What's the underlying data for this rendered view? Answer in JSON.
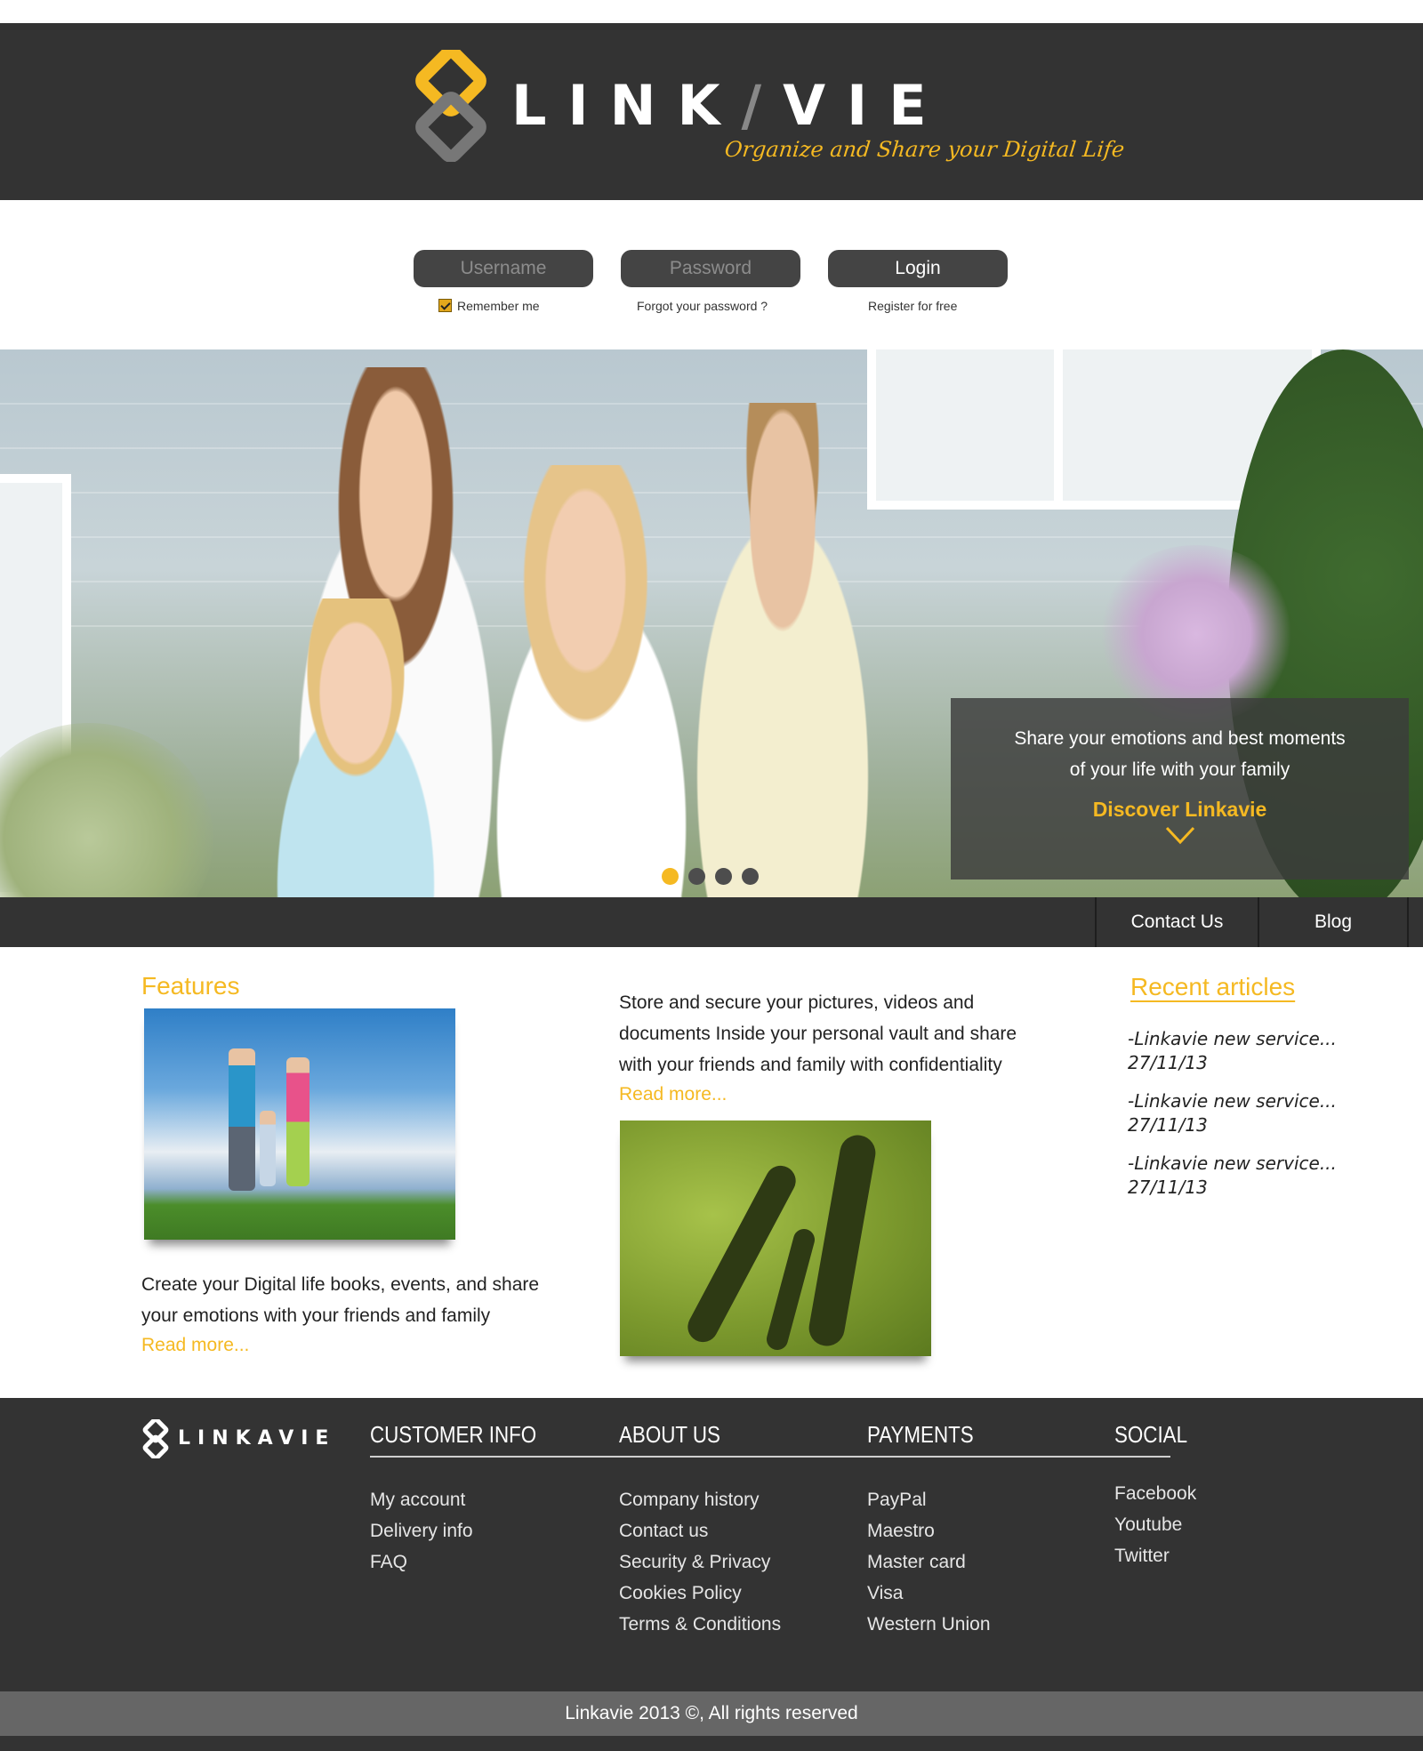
{
  "brand": {
    "name": "LINKAVIE",
    "tagline": "Organize and Share your Digital Life",
    "accent_color": "#f5b922",
    "dark_color": "#333333"
  },
  "login": {
    "username_placeholder": "Username",
    "password_placeholder": "Password",
    "login_label": "Login",
    "remember_label": "Remember me",
    "remember_checked": true,
    "forgot_label": "Forgot your password ?",
    "register_label": "Register for free"
  },
  "hero": {
    "caption_line1": "Share your emotions and best moments",
    "caption_line2": "of your life with your family",
    "discover_label": "Discover Linkavie",
    "slides_total": 4,
    "active_slide": 1
  },
  "nav": {
    "items": [
      {
        "label": "Contact Us"
      },
      {
        "label": "Blog"
      }
    ]
  },
  "features": {
    "title": "Features",
    "left_text_line1": "Create your Digital life books, events, and share",
    "left_text_line2": "your emotions with your friends and family",
    "left_read_more": "Read more...",
    "mid_text_line1": "Store and secure your pictures, videos and",
    "mid_text_line2": "documents Inside your personal vault and share",
    "mid_text_line3": "with your friends and family with confidentiality",
    "mid_read_more": "Read more..."
  },
  "recent_articles": {
    "title": "Recent articles",
    "items": [
      {
        "title": "-Linkavie new service...",
        "date": "27/11/13"
      },
      {
        "title": "-Linkavie new service...",
        "date": "27/11/13"
      },
      {
        "title": "-Linkavie new service...",
        "date": "27/11/13"
      }
    ]
  },
  "footer": {
    "logo_text": "LINKAVIE",
    "columns": [
      {
        "heading": "CUSTOMER INFO",
        "links": [
          "My account",
          "Delivery info",
          "FAQ"
        ]
      },
      {
        "heading": "ABOUT US",
        "links": [
          "Company history",
          "Contact us",
          "Security & Privacy",
          "Cookies Policy",
          "Terms & Conditions"
        ]
      },
      {
        "heading": "PAYMENTS",
        "links": [
          "PayPal",
          "Maestro",
          "Master card",
          "Visa",
          "Western Union"
        ]
      },
      {
        "heading": "SOCIAL",
        "links": [
          "Facebook",
          "Youtube",
          "Twitter"
        ]
      }
    ],
    "copyright": "Linkavie 2013 ©, All rights reserved"
  }
}
